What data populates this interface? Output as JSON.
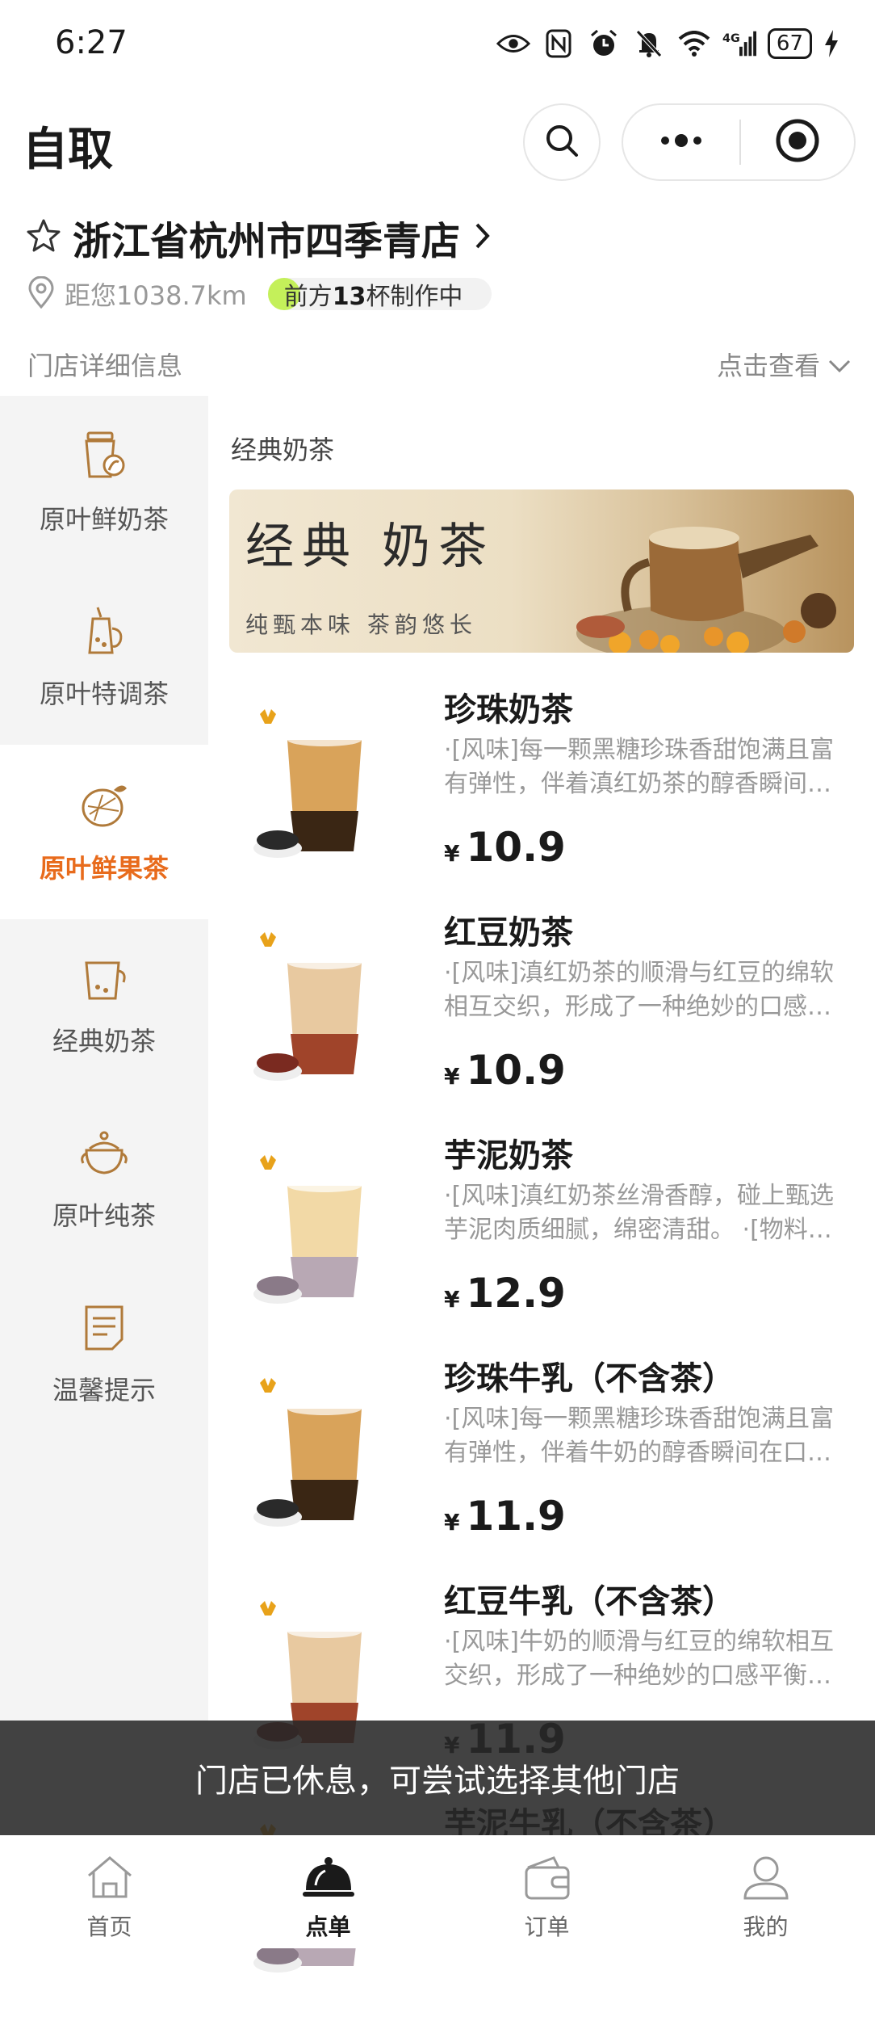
{
  "status_bar": {
    "time": "6:27",
    "battery": "67"
  },
  "header": {
    "title": "自取"
  },
  "store": {
    "name": "浙江省杭州市四季青店",
    "distance": "距您1038.7km",
    "queue_prefix": "前方",
    "queue_count": "13",
    "queue_suffix": "杯制作中",
    "detail_label": "门店详细信息",
    "detail_link": "点击查看"
  },
  "sidebar": {
    "items": [
      {
        "label": "原叶鲜奶茶",
        "icon": "milk-tea-cup-icon",
        "active": false
      },
      {
        "label": "原叶特调茶",
        "icon": "special-tea-icon",
        "active": false
      },
      {
        "label": "原叶鲜果茶",
        "icon": "fruit-tea-icon",
        "active": true
      },
      {
        "label": "经典奶茶",
        "icon": "classic-milk-tea-icon",
        "active": false
      },
      {
        "label": "原叶纯茶",
        "icon": "teapot-icon",
        "active": false
      },
      {
        "label": "温馨提示",
        "icon": "notice-icon",
        "active": false
      }
    ]
  },
  "section": {
    "title": "经典奶茶",
    "banner_title": "经典 奶茶",
    "banner_subtitle": "纯甄本味 茶韵悠长"
  },
  "products": [
    {
      "name": "珍珠奶茶",
      "desc": "·[风味]每一颗黑糖珍珠香甜饱满且富有弹性，伴着滇红奶茶的醇香瞬间…",
      "currency": "¥",
      "price": "10.9",
      "topping": "pearl"
    },
    {
      "name": "红豆奶茶",
      "desc": "·[风味]滇红奶茶的顺滑与红豆的绵软相互交织，形成了一种绝妙的口感…",
      "currency": "¥",
      "price": "10.9",
      "topping": "red-bean"
    },
    {
      "name": "芋泥奶茶",
      "desc": "·[风味]滇红奶茶丝滑香醇，碰上甄选芋泥肉质细腻，绵密清甜。 ·[物料…",
      "currency": "¥",
      "price": "12.9",
      "topping": "taro"
    },
    {
      "name": "珍珠牛乳（不含茶）",
      "desc": "·[风味]每一颗黑糖珍珠香甜饱满且富有弹性，伴着牛奶的醇香瞬间在口…",
      "currency": "¥",
      "price": "11.9",
      "topping": "pearl"
    },
    {
      "name": "红豆牛乳（不含茶）",
      "desc": "·[风味]牛奶的顺滑与红豆的绵软相互交织，形成了一种绝妙的口感平衡…",
      "currency": "¥",
      "price": "11.9",
      "topping": "red-bean"
    },
    {
      "name": "芋泥牛乳（不含茶）",
      "desc": "",
      "currency": "",
      "price": "",
      "topping": "taro"
    }
  ],
  "toast": {
    "text": "门店已休息，可尝试选择其他门店"
  },
  "bottom_nav": {
    "items": [
      {
        "label": "首页",
        "icon": "home-icon",
        "active": false
      },
      {
        "label": "点单",
        "icon": "order-cloche-icon",
        "active": true
      },
      {
        "label": "订单",
        "icon": "orders-wallet-icon",
        "active": false
      },
      {
        "label": "我的",
        "icon": "profile-icon",
        "active": false
      }
    ]
  },
  "colors": {
    "accent": "#e86b1c",
    "queue_indicator": "#c4f05a",
    "sidebar_bg": "#f4f4f4"
  }
}
